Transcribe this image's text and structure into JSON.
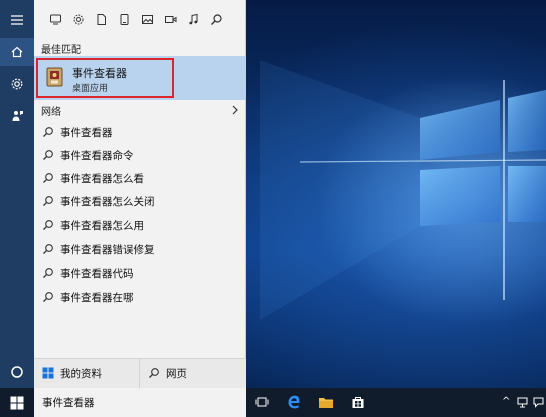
{
  "search": {
    "query": "事件查看器"
  },
  "best_match": {
    "header": "最佳匹配",
    "title": "事件查看器",
    "subtitle": "桌面应用"
  },
  "web": {
    "header": "网络",
    "suggestions": [
      "事件查看器",
      "事件查看器命令",
      "事件查看器怎么看",
      "事件查看器怎么关闭",
      "事件查看器怎么用",
      "事件查看器错误修复",
      "事件查看器代码",
      "事件查看器在哪"
    ]
  },
  "bottom": {
    "my_info": "我的资料",
    "web": "网页"
  },
  "filters": [
    "apps-icon",
    "settings-icon",
    "documents-icon",
    "folders-icon",
    "photos-icon",
    "videos-icon",
    "music-icon",
    "search-icon"
  ],
  "colors": {
    "accent": "#b9d3ef",
    "highlight_border": "#d9262c",
    "rail": "#1f3d63",
    "taskbar": "#101c2c"
  }
}
